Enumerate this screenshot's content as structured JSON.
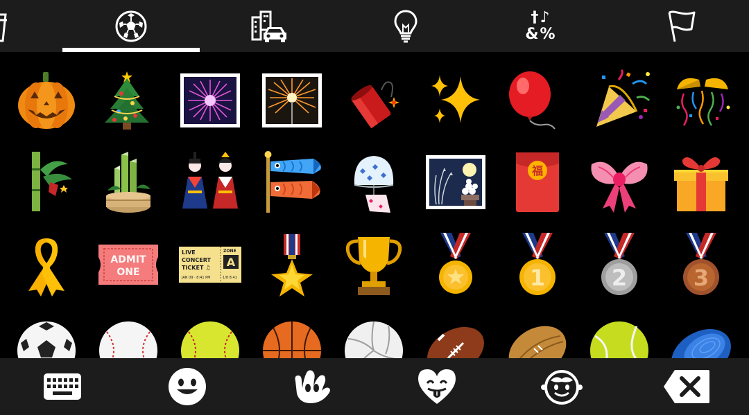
{
  "category_tabs": [
    {
      "id": "food",
      "icon": "cup-icon",
      "selected": false
    },
    {
      "id": "activity",
      "icon": "soccer-ball-icon",
      "selected": true
    },
    {
      "id": "travel",
      "icon": "buildings-car-icon",
      "selected": false
    },
    {
      "id": "objects",
      "icon": "light-bulb-icon",
      "selected": false
    },
    {
      "id": "symbols",
      "icon": "symbols-icon",
      "selected": false,
      "glyph_top": "†♪",
      "glyph_bottom": "&%"
    },
    {
      "id": "flags",
      "icon": "flag-icon",
      "selected": false
    }
  ],
  "emoji_rows": [
    [
      "🎃",
      "🎄",
      "🎆",
      "🎇",
      "🧨",
      "✨",
      "🎈",
      "🎉",
      "🎊"
    ],
    [
      "🎋",
      "🎍",
      "🎎",
      "🎏",
      "🎐",
      "🎑",
      "🧧",
      "🎀",
      "🎁"
    ],
    [
      "🎗",
      "🎟",
      "🎫",
      "🎖",
      "🏆",
      "🏅",
      "🥇",
      "🥈",
      "🥉"
    ],
    [
      "⚽",
      "⚾",
      "🥎",
      "🏀",
      "🏐",
      "🏈",
      "🏉",
      "🎾",
      "🥏"
    ]
  ],
  "emoji_names": [
    [
      "jack-o-lantern",
      "christmas-tree",
      "fireworks",
      "sparkler",
      "firecracker",
      "sparkles",
      "balloon",
      "party-popper",
      "confetti-ball"
    ],
    [
      "tanabata-tree",
      "pine-decoration",
      "japanese-dolls",
      "carp-streamer",
      "wind-chime",
      "moon-viewing-ceremony",
      "red-envelope",
      "ribbon",
      "wrapped-gift"
    ],
    [
      "reminder-ribbon",
      "admission-tickets",
      "ticket",
      "military-medal",
      "trophy",
      "sports-medal",
      "1st-place-medal",
      "2nd-place-medal",
      "3rd-place-medal"
    ],
    [
      "soccer-ball",
      "baseball",
      "softball",
      "basketball",
      "volleyball",
      "american-football",
      "rugby-football",
      "tennis",
      "flying-disc"
    ]
  ],
  "tickets": {
    "admit_top": "ADMIT",
    "admit_bottom": "ONE",
    "live_line1": "LIVE",
    "live_line2": "CONCERT",
    "live_line3": "TICKET ♫",
    "zone_label": "ZONE",
    "zone_letter": "A",
    "date_text": "JAN 09 · 8:41 PM",
    "seat_text": "1/8 8:41"
  },
  "red_envelope_char": "福",
  "medal_numbers": [
    "1",
    "2",
    "3"
  ],
  "bottom_bar": [
    {
      "id": "keyboard",
      "icon": "keyboard-icon"
    },
    {
      "id": "smileys",
      "icon": "smiley-icon"
    },
    {
      "id": "gestures",
      "icon": "hand-icon"
    },
    {
      "id": "emoticons",
      "icon": "heart-tongue-icon"
    },
    {
      "id": "kaomoji",
      "icon": "baby-face-icon"
    },
    {
      "id": "delete",
      "icon": "backspace-icon"
    }
  ],
  "colors": {
    "bar_background": "#1c1c1c",
    "grid_background": "#000000",
    "selected_underline": "#ffffff",
    "icon_color": "#ffffff"
  }
}
